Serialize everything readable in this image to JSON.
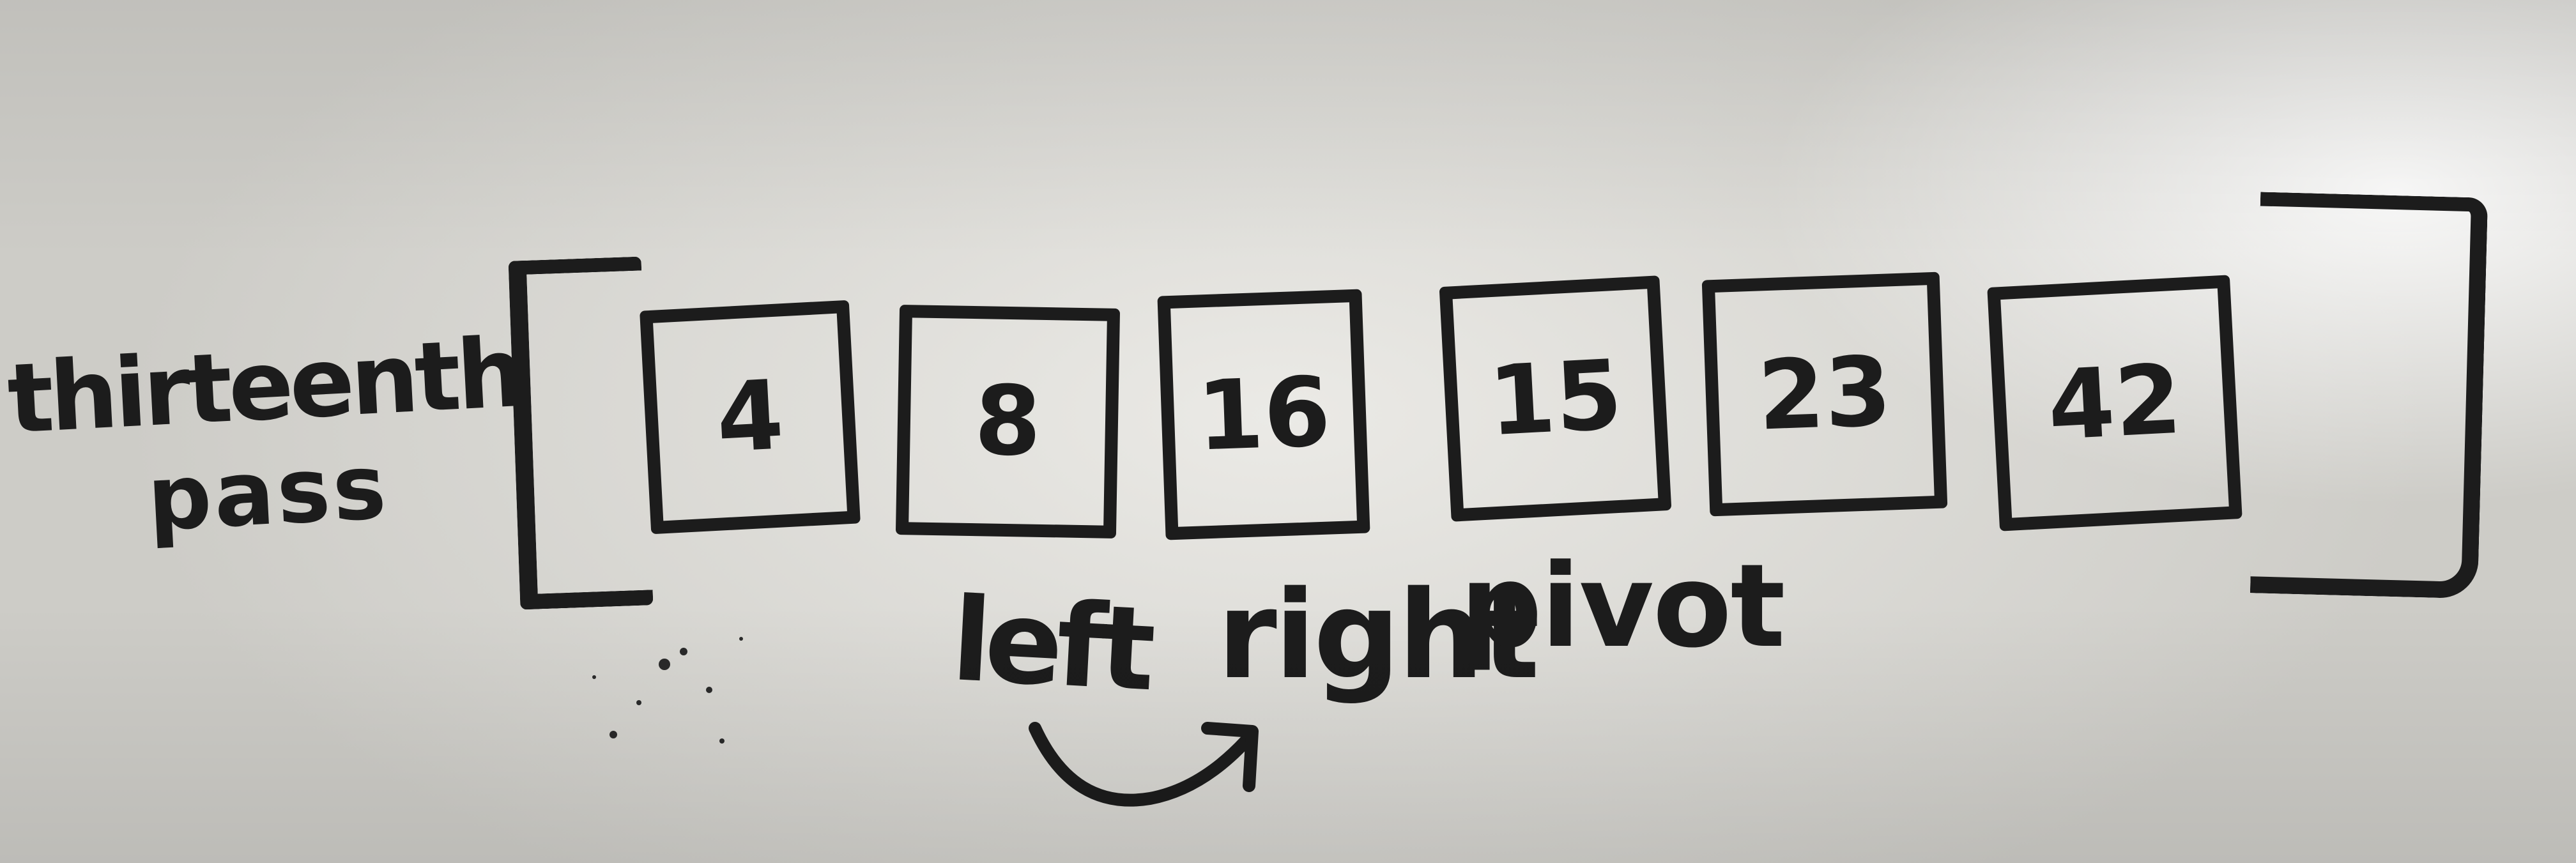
{
  "pass_label": {
    "line1": "thirteenth",
    "line2": "pass"
  },
  "array": {
    "values": [
      "4",
      "8",
      "16",
      "15",
      "23",
      "42"
    ]
  },
  "pointers": {
    "left": "left",
    "right": "right",
    "pivot": "pivot"
  },
  "colors": {
    "ink": "#1c1c1c",
    "board": "#dcdad5"
  },
  "icons": {
    "arrow": "curved-arrow-icon"
  }
}
